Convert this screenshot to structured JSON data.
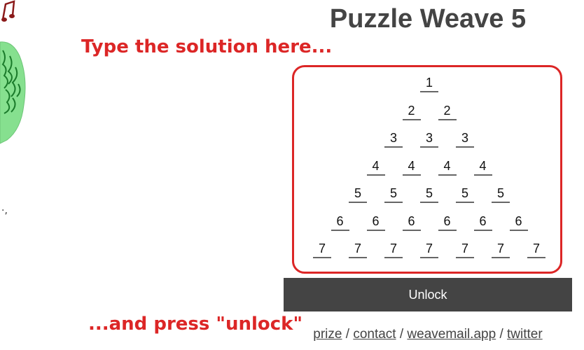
{
  "title": "Puzzle Weave 5",
  "annotations": {
    "top": "Type the solution here...",
    "bottom": "...and press \"unlock\""
  },
  "puzzle": {
    "rows": [
      [
        "1"
      ],
      [
        "2",
        "2"
      ],
      [
        "3",
        "3",
        "3"
      ],
      [
        "4",
        "4",
        "4",
        "4"
      ],
      [
        "5",
        "5",
        "5",
        "5",
        "5"
      ],
      [
        "6",
        "6",
        "6",
        "6",
        "6",
        "6"
      ],
      [
        "7",
        "7",
        "7",
        "7",
        "7",
        "7",
        "7"
      ]
    ]
  },
  "unlock_label": "Unlock",
  "footer": {
    "links": [
      "prize",
      "contact",
      "weavemail.app",
      "twitter"
    ],
    "separator": "/"
  },
  "colors": {
    "accent_red": "#dc2626",
    "title_gray": "#444444",
    "button_bg": "#444444",
    "button_text": "#ffffff",
    "deco_green": "#7fe08a",
    "deco_dark_green": "#1a7a2a",
    "deco_note": "#8b1a1a"
  },
  "icons": {
    "deco": "music-note-icon",
    "drawing": "green-scribble-drawing"
  }
}
